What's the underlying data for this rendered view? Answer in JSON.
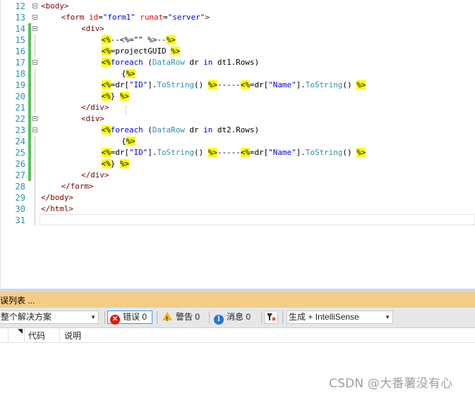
{
  "editor": {
    "lines": [
      {
        "no": "12",
        "fold": "open",
        "bar": false,
        "indent": 0,
        "tokens": [
          [
            "tag",
            "<body>"
          ]
        ]
      },
      {
        "no": "13",
        "fold": "open",
        "bar": false,
        "indent": 1,
        "tokens": [
          [
            "tag",
            "<form "
          ],
          [
            "att",
            "id"
          ],
          [
            "pun",
            "="
          ],
          [
            "str",
            "\"form1\""
          ],
          [
            "txt",
            " "
          ],
          [
            "att",
            "runat"
          ],
          [
            "pun",
            "="
          ],
          [
            "str",
            "\"server\""
          ],
          [
            "tag",
            ">"
          ]
        ]
      },
      {
        "no": "14",
        "fold": "open",
        "bar": true,
        "indent": 2,
        "tokens": [
          [
            "tag",
            "<div>"
          ]
        ]
      },
      {
        "no": "15",
        "fold": "",
        "bar": true,
        "indent": 3,
        "tokens": [
          [
            "dlm",
            "<%"
          ],
          [
            "cmt",
            "--<%=\"\" %>--"
          ],
          [
            "dlm",
            "%>"
          ]
        ]
      },
      {
        "no": "16",
        "fold": "",
        "bar": true,
        "indent": 3,
        "tokens": [
          [
            "dlm",
            "<%"
          ],
          [
            "txt",
            "=projectGUID "
          ],
          [
            "dlm",
            "%>"
          ]
        ]
      },
      {
        "no": "17",
        "fold": "open",
        "bar": true,
        "indent": 3,
        "tokens": [
          [
            "dlm",
            "<%"
          ],
          [
            "kw",
            "foreach"
          ],
          [
            "txt",
            " ("
          ],
          [
            "cls",
            "DataRow"
          ],
          [
            "txt",
            " dr "
          ],
          [
            "kw",
            "in"
          ],
          [
            "txt",
            " dt1.Rows)"
          ]
        ]
      },
      {
        "no": "18",
        "fold": "",
        "bar": true,
        "indent": 4,
        "tokens": [
          [
            "txt",
            "{"
          ],
          [
            "dlm",
            "%>"
          ]
        ]
      },
      {
        "no": "19",
        "fold": "",
        "bar": true,
        "indent": 3,
        "tokens": [
          [
            "dlm",
            "<%"
          ],
          [
            "txt",
            "=dr["
          ],
          [
            "str",
            "\"ID\""
          ],
          [
            "txt",
            "]."
          ],
          [
            "cls",
            "ToString"
          ],
          [
            "txt",
            "() "
          ],
          [
            "dlm",
            "%>"
          ],
          [
            "txt",
            "-----"
          ],
          [
            "dlm",
            "<%"
          ],
          [
            "txt",
            "=dr["
          ],
          [
            "str",
            "\"Name\""
          ],
          [
            "txt",
            "]."
          ],
          [
            "cls",
            "ToString"
          ],
          [
            "txt",
            "() "
          ],
          [
            "dlm",
            "%>"
          ]
        ]
      },
      {
        "no": "20",
        "fold": "",
        "bar": true,
        "indent": 3,
        "tokens": [
          [
            "dlm",
            "<%"
          ],
          [
            "txt",
            "} "
          ],
          [
            "dlm",
            "%>"
          ]
        ]
      },
      {
        "no": "21",
        "fold": "",
        "bar": true,
        "indent": 2,
        "tokens": [
          [
            "tag",
            "</div>"
          ]
        ]
      },
      {
        "no": "22",
        "fold": "open",
        "bar": true,
        "indent": 2,
        "tokens": [
          [
            "tag",
            "<div>"
          ]
        ]
      },
      {
        "no": "23",
        "fold": "open",
        "bar": true,
        "indent": 3,
        "tokens": [
          [
            "dlm",
            "<%"
          ],
          [
            "kw",
            "foreach"
          ],
          [
            "txt",
            " ("
          ],
          [
            "cls",
            "DataRow"
          ],
          [
            "txt",
            " dr "
          ],
          [
            "kw",
            "in"
          ],
          [
            "txt",
            " dt2.Rows)"
          ]
        ]
      },
      {
        "no": "24",
        "fold": "",
        "bar": true,
        "indent": 4,
        "tokens": [
          [
            "txt",
            "{"
          ],
          [
            "dlm",
            "%>"
          ]
        ]
      },
      {
        "no": "25",
        "fold": "",
        "bar": true,
        "indent": 3,
        "tokens": [
          [
            "dlm",
            "<%"
          ],
          [
            "txt",
            "=dr["
          ],
          [
            "str",
            "\"ID\""
          ],
          [
            "txt",
            "]."
          ],
          [
            "cls",
            "ToString"
          ],
          [
            "txt",
            "() "
          ],
          [
            "dlm",
            "%>"
          ],
          [
            "txt",
            "-----"
          ],
          [
            "dlm",
            "<%"
          ],
          [
            "txt",
            "=dr["
          ],
          [
            "str",
            "\"Name\""
          ],
          [
            "txt",
            "]."
          ],
          [
            "cls",
            "ToString"
          ],
          [
            "txt",
            "() "
          ],
          [
            "dlm",
            "%>"
          ]
        ]
      },
      {
        "no": "26",
        "fold": "",
        "bar": true,
        "indent": 3,
        "tokens": [
          [
            "dlm",
            "<%"
          ],
          [
            "txt",
            "} "
          ],
          [
            "dlm",
            "%>"
          ]
        ]
      },
      {
        "no": "27",
        "fold": "",
        "bar": true,
        "indent": 2,
        "tokens": [
          [
            "tag",
            "</div>"
          ]
        ]
      },
      {
        "no": "28",
        "fold": "",
        "bar": false,
        "indent": 1,
        "tokens": [
          [
            "tag",
            "</form>"
          ]
        ]
      },
      {
        "no": "29",
        "fold": "",
        "bar": false,
        "indent": 0,
        "tokens": [
          [
            "tag",
            "</body>"
          ]
        ]
      },
      {
        "no": "30",
        "fold": "",
        "bar": false,
        "indent": 0,
        "tokens": [
          [
            "tag",
            "</html>"
          ]
        ]
      },
      {
        "no": "31",
        "fold": "",
        "bar": false,
        "indent": 0,
        "tokens": []
      }
    ]
  },
  "error_list": {
    "title": "误列表 ...",
    "scope_select": "整个解决方案",
    "errors_label": "错误 0",
    "warnings_label": "警告 0",
    "messages_label": "消息 0",
    "build_select": "生成 + IntelliSense",
    "columns": {
      "code": "代码",
      "description": "说明"
    }
  },
  "watermark": "CSDN @大番薯没有心",
  "colors": {
    "tag": "#800000",
    "attribute": "#ff0000",
    "string": "#0000ff",
    "keyword": "#0000ff",
    "class": "#2b91af",
    "delimiter_bg": "#ffff00",
    "line_number": "#2b91af",
    "change_bar": "#57c353",
    "panel_title_bg": "#f5cc84"
  },
  "icons": [
    "error-icon",
    "warning-icon",
    "info-icon",
    "filter-icon",
    "dropdown-arrow-icon"
  ]
}
